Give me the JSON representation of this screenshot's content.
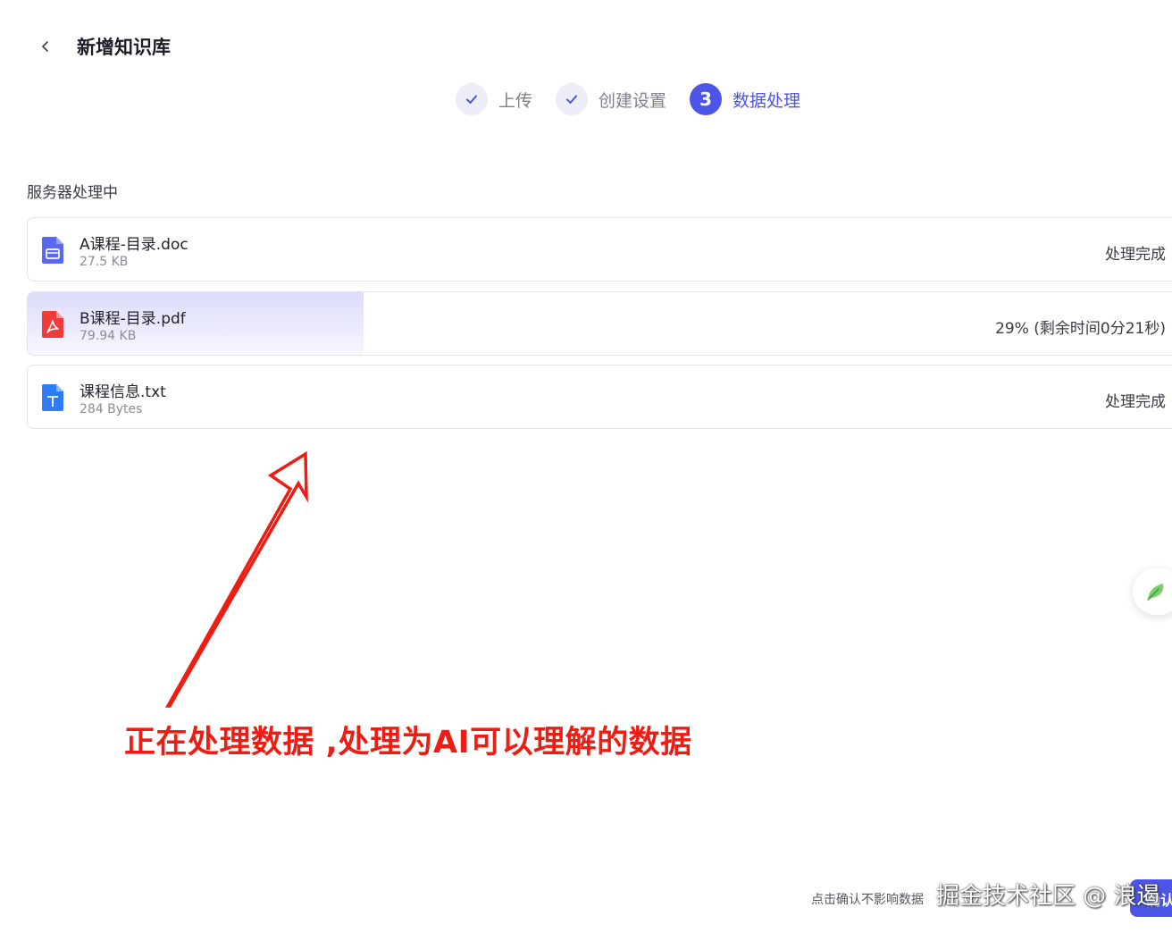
{
  "header": {
    "back_icon": "chevron-left-icon",
    "title": "新增知识库"
  },
  "steps": [
    {
      "label": "上传",
      "state": "done",
      "icon": "check-icon"
    },
    {
      "label": "创建设置",
      "state": "done",
      "icon": "check-icon"
    },
    {
      "label": "数据处理",
      "state": "active",
      "number": "3"
    }
  ],
  "section": {
    "title": "服务器处理中"
  },
  "files": [
    {
      "name": "A课程-目录.doc",
      "size": "27.5 KB",
      "status": "处理完成",
      "icon": "doc-file-icon",
      "progress": 1.0
    },
    {
      "name": "B课程-目录.pdf",
      "size": "79.94 KB",
      "status": "29% (剩余时间0分21秒)",
      "icon": "pdf-file-icon",
      "progress": 0.29
    },
    {
      "name": "课程信息.txt",
      "size": "284 Bytes",
      "status": "处理完成",
      "icon": "txt-file-icon",
      "progress": 1.0
    }
  ],
  "annotation": {
    "text": "正在处理数据 ,处理为AI可以理解的数据",
    "color": "#ee1c12"
  },
  "footer": {
    "note": "点击确认不影响数据",
    "confirm_label": "确认"
  },
  "watermark": "掘金技术社区 @ 浪遏",
  "colors": {
    "accent": "#4c55e6",
    "doc_icon": "#5a67f2",
    "pdf_icon": "#ef3b3b",
    "txt_icon": "#2f7bf6"
  }
}
